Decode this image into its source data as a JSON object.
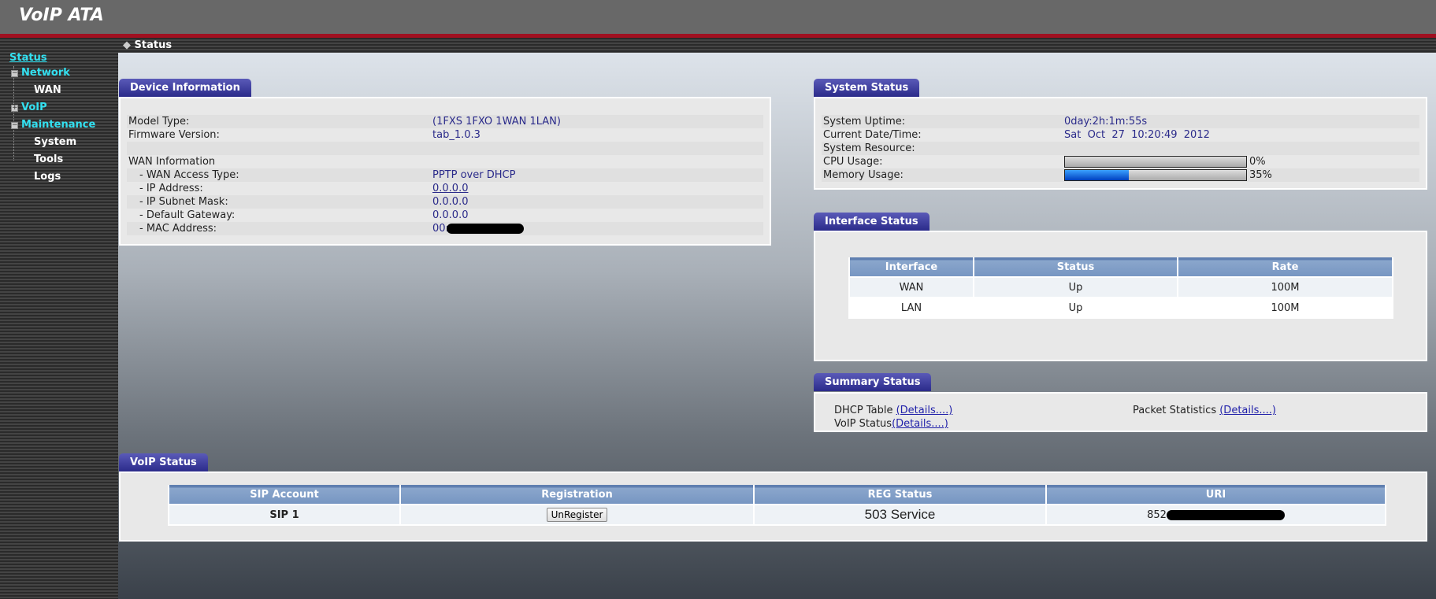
{
  "header": {
    "title": "VoIP ATA"
  },
  "breadcrumb": "Status",
  "sidebar": {
    "status": "Status",
    "network": "Network",
    "wan": "WAN",
    "voip": "VoIP",
    "maintenance": "Maintenance",
    "system": "System",
    "tools": "Tools",
    "logs": "Logs"
  },
  "device": {
    "title": "Device Information",
    "rows": [
      {
        "label": "Model Type:",
        "value": "(1FXS 1FXO 1WAN 1LAN)"
      },
      {
        "label": "Firmware Version:",
        "value": "tab_1.0.3"
      },
      {
        "label": "",
        "value": ""
      },
      {
        "label": "WAN Information",
        "value": ""
      },
      {
        "label": "- WAN Access Type:",
        "value": "PPTP over DHCP"
      },
      {
        "label": "- IP Address:",
        "value": "0.0.0.0"
      },
      {
        "label": "- IP Subnet Mask:",
        "value": "0.0.0.0"
      },
      {
        "label": "- Default Gateway:",
        "value": "0.0.0.0"
      },
      {
        "label": "- MAC Address:",
        "value": "00:"
      }
    ]
  },
  "system": {
    "title": "System Status",
    "uptime_label": "System Uptime:",
    "uptime": "0day:2h:1m:55s",
    "date_label": "Current Date/Time:",
    "date": "Sat  Oct  27  10:20:49  2012",
    "resource_label": "System Resource:",
    "cpu_label": "CPU Usage:",
    "cpu": "0%",
    "cpu_value": 0,
    "mem_label": "Memory Usage:",
    "mem": "35%",
    "mem_value": 35
  },
  "iface": {
    "title": "Interface Status",
    "headers": [
      "Interface",
      "Status",
      "Rate"
    ],
    "rows": [
      [
        "WAN",
        "Up",
        "100M"
      ],
      [
        "LAN",
        "Up",
        "100M"
      ]
    ]
  },
  "summary": {
    "title": "Summary Status",
    "dhcp": "DHCP Table ",
    "packet": "Packet Statistics ",
    "voip": "VoIP Status",
    "details": "(Details....)"
  },
  "voip": {
    "title": "VoIP Status",
    "headers": [
      "SIP Account",
      "Registration",
      "REG Status",
      "URI"
    ],
    "account": "SIP 1",
    "button": "UnRegister",
    "reg_status": "503 Service",
    "uri": "852"
  },
  "colors": {
    "tab": "#2b2b8a",
    "accent_red": "#a01020",
    "nav": "#33e0f0"
  }
}
